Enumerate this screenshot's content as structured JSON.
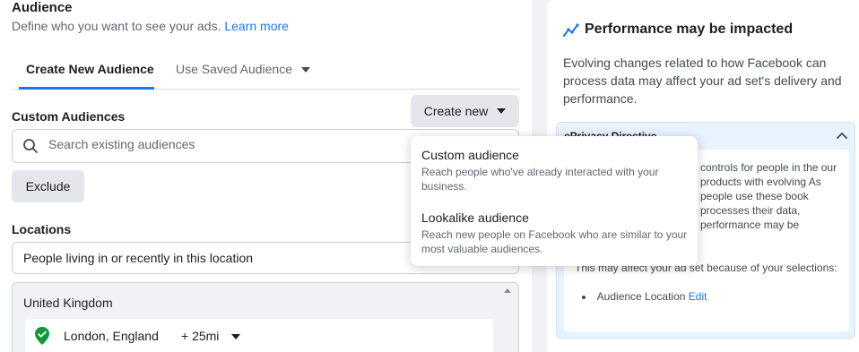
{
  "audience": {
    "title": "Audience",
    "subtitle": "Define who you want to see your ads.",
    "learn_more": "Learn more"
  },
  "tabs": [
    {
      "label": "Create New Audience",
      "active": true
    },
    {
      "label": "Use Saved Audience",
      "active": false
    }
  ],
  "custom_audiences": {
    "label": "Custom Audiences",
    "create_button": "Create new",
    "search_placeholder": "Search existing audiences",
    "exclude_button": "Exclude"
  },
  "create_menu": {
    "items": [
      {
        "title": "Custom audience",
        "description": "Reach people who've already interacted with your business."
      },
      {
        "title": "Lookalike audience",
        "description": "Reach new people on Facebook who are similar to your most valuable audiences."
      }
    ]
  },
  "locations": {
    "label": "Locations",
    "selector_value": "People living in or recently in this location",
    "country": "United Kingdom",
    "city": "London, England",
    "radius": "+ 25mi"
  },
  "performance": {
    "title": "Performance may be impacted",
    "body": "Evolving changes related to how Facebook can process data may affect your ad set's delivery and performance."
  },
  "eprivacy": {
    "title": "ePrivacy Directive",
    "text": "controls for people in the our products with evolving As people use these book processes their data, performance may be",
    "affect_line": "This may affect your ad set because of your selections:",
    "bullet_label": "Audience Location",
    "bullet_link": "Edit"
  },
  "colors": {
    "accent": "#1877f2",
    "panel_blue": "#e7f3ff",
    "pin_green": "#0a9a38"
  }
}
